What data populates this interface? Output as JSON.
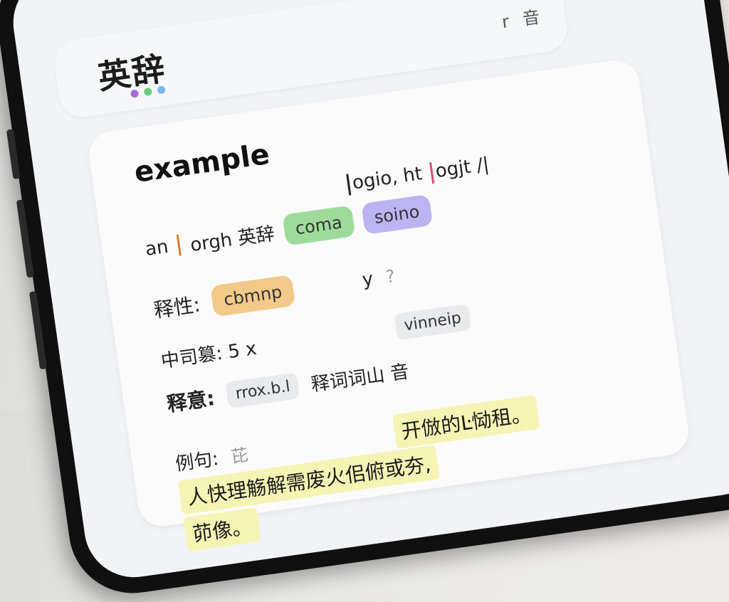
{
  "header": {
    "app_title": "英辞",
    "top_action": "r 音",
    "back_glyph": "‹",
    "dots": [
      "#a86ad8",
      "#6acb7d",
      "#7fb7f0"
    ]
  },
  "entry": {
    "word": "example",
    "phonetic_row": {
      "text_a": "ogio, ht",
      "text_b": "ogjt /|"
    },
    "pron_row": {
      "prefix": "an",
      "mid": "orgh 英辞",
      "tags": [
        {
          "label": "cbmnp",
          "color": "#f3c98a"
        },
        {
          "label": "coma",
          "color": "#9edb9b"
        },
        {
          "label": "soino",
          "color": "#bcb4f2"
        }
      ]
    },
    "pos_row": {
      "label": "释性:",
      "tag": "cbmnp",
      "tag_color": "#f3c98a",
      "extra": "y",
      "extra_hint": "?"
    },
    "freq_row": {
      "label": "中司篡: 5 x",
      "chip": "vinneip"
    },
    "meaning_row": {
      "label": "释意:",
      "chip": "rrox.b.l",
      "text": "释词词山 音"
    },
    "example_row": {
      "label": "例句:",
      "label_hint": "芘"
    },
    "example_lines": [
      "开倣的Ŀ恸租。",
      "人快理觞解需废火佀俯或夯,",
      "茆像。"
    ]
  }
}
